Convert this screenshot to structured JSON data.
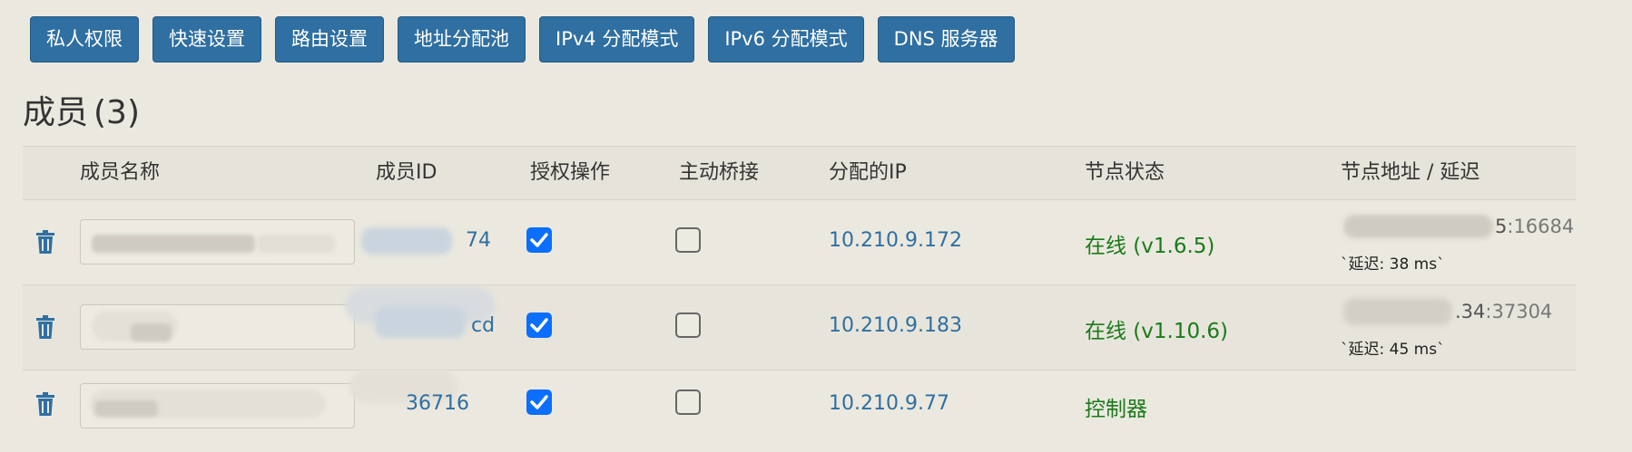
{
  "toolbar": {
    "buttons": [
      "私人权限",
      "快速设置",
      "路由设置",
      "地址分配池",
      "IPv4 分配模式",
      "IPv6 分配模式",
      "DNS 服务器"
    ]
  },
  "members": {
    "title": "成员",
    "count": "(3)",
    "columns": [
      "成员名称",
      "成员ID",
      "授权操作",
      "主动桥接",
      "分配的IP",
      "节点状态",
      "节点地址 / 延迟"
    ],
    "rows": [
      {
        "id_suffix": "74",
        "authorized": true,
        "bridge": false,
        "ip": "10.210.9.172",
        "status": "在线 (v1.6.5)",
        "addr_visible": "5",
        "addr_port": ":16684",
        "latency": "`延迟: 38 ms`"
      },
      {
        "id_suffix": "cd",
        "authorized": true,
        "bridge": false,
        "ip": "10.210.9.183",
        "status": "在线 (v1.10.6)",
        "addr_visible": ".34",
        "addr_port": ":37304",
        "latency": "`延迟: 45 ms`"
      },
      {
        "id_suffix": "36716",
        "authorized": true,
        "bridge": false,
        "ip": "10.210.9.77",
        "status": "控制器",
        "addr_visible": "",
        "addr_port": "",
        "latency": ""
      }
    ]
  },
  "colors": {
    "button_bg": "#2f6fa1",
    "link": "#2f6fa1",
    "online": "#1a7a1a",
    "checkbox_on": "#0b6efd",
    "page_bg": "#ebe9df"
  },
  "icons": {
    "delete": "trash-icon",
    "checked": "check-icon"
  }
}
